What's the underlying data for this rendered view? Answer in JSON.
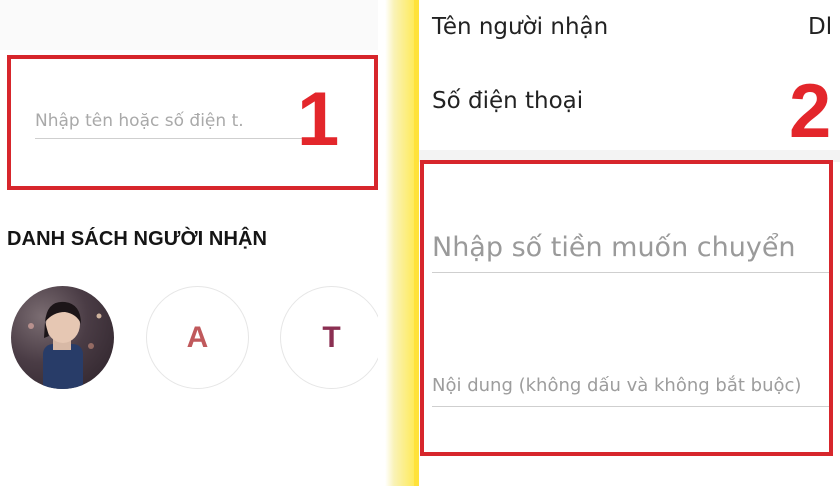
{
  "left_screen": {
    "search": {
      "value": "",
      "placeholder": "Nhập tên hoặc số điện t."
    },
    "step_number": "1",
    "recipient_list": {
      "heading": "DANH SÁCH NGƯỜI NHẬN",
      "contacts": [
        {
          "initial": "",
          "kind": "photo-avatar"
        },
        {
          "initial": "A",
          "color": "#c0595c"
        },
        {
          "initial": "T",
          "color": "#8b2f52"
        }
      ]
    }
  },
  "right_screen": {
    "recipient_name_label": "Tên người nhận",
    "recipient_name_value": "Dl",
    "phone_label": "Số điện thoại",
    "step_number": "2",
    "amount": {
      "value": "",
      "placeholder": "Nhập số tiền muốn chuyển"
    },
    "note": {
      "value": "",
      "placeholder": "Nội dung (không dấu và không bắt buộc)"
    }
  },
  "colors": {
    "highlight": "#d7262c",
    "step_label": "#e3262b",
    "divider": "#ffe23a"
  }
}
